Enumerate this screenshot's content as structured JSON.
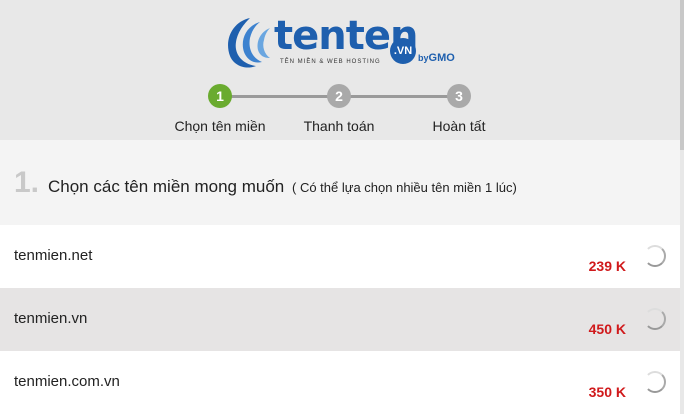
{
  "brand": {
    "name": "tenten",
    "vn_badge": ".VN",
    "tagline": "TÊN MIỀN & WEB HOSTING",
    "by": "by",
    "gmo": "GMO"
  },
  "steps": [
    {
      "number": "1",
      "label": "Chọn tên miền",
      "state": "active"
    },
    {
      "number": "2",
      "label": "Thanh toán",
      "state": "pending"
    },
    {
      "number": "3",
      "label": "Hoàn tất",
      "state": "pending"
    }
  ],
  "section": {
    "number": "1.",
    "title": "Chọn các tên miền mong muốn",
    "subtitle": "( Có thể lựa chọn nhiều tên miền 1 lúc)"
  },
  "domains": [
    {
      "name": "tenmien.net",
      "price": "239 K"
    },
    {
      "name": "tenmien.vn",
      "price": "450 K"
    },
    {
      "name": "tenmien.com.vn",
      "price": "350 K"
    }
  ],
  "colors": {
    "active_step": "#6aab2f",
    "pending_step": "#a9a9a9",
    "price": "#d0191b",
    "brand_blue": "#1e5fae"
  }
}
